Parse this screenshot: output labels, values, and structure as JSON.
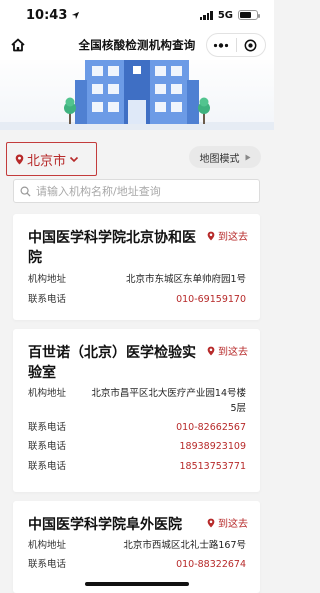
{
  "status": {
    "time": "10:43",
    "network": "5G"
  },
  "nav": {
    "title": "全国核酸检测机构查询",
    "more_icon": "more-dots-icon",
    "close_icon": "target-icon"
  },
  "city": {
    "label": "北京市"
  },
  "map_mode": {
    "label": "地图模式"
  },
  "search": {
    "placeholder": "请输入机构名称/地址查询"
  },
  "labels": {
    "address": "机构地址",
    "phone": "联系电话",
    "go": "到这去"
  },
  "colors": {
    "accent": "#b72a2a",
    "building": "#5b8ee0"
  },
  "institutions": [
    {
      "name": "中国医学科学院北京协和医院",
      "address": "北京市东城区东单帅府园1号",
      "phones": [
        "010-69159170"
      ]
    },
    {
      "name": "百世诺（北京）医学检验实验室",
      "address": "北京市昌平区北大医疗产业园14号楼5层",
      "phones": [
        "010-82662567",
        "18938923109",
        "18513753771"
      ]
    },
    {
      "name": "中国医学科学院阜外医院",
      "address": "北京市西城区北礼士路167号",
      "phones": [
        "010-88322674"
      ]
    }
  ]
}
